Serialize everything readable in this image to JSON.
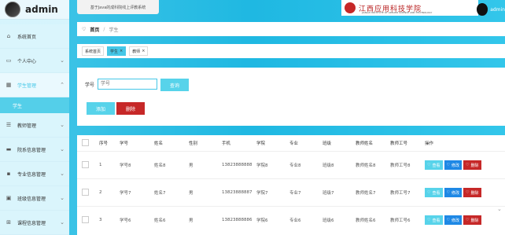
{
  "sidebar": {
    "brand": "admin",
    "items": [
      {
        "label": "系统首页",
        "icon": "home-icon"
      },
      {
        "label": "个人中心",
        "icon": "user-card-icon"
      },
      {
        "label": "学生管理",
        "icon": "grid-icon",
        "active": true
      },
      {
        "label": "学生",
        "submenu": true
      },
      {
        "label": "教师管理",
        "icon": "sliders-icon"
      },
      {
        "label": "院系信息管理",
        "icon": "message-icon"
      },
      {
        "label": "专业信息管理",
        "icon": "briefcase-icon"
      },
      {
        "label": "班级信息管理",
        "icon": "screen-icon"
      },
      {
        "label": "课程信息管理",
        "icon": "apps-icon"
      }
    ]
  },
  "header": {
    "system_title": "基于Java的成科院线上评教系统",
    "school_cn": "江西应用科技学院",
    "school_en": "JIANGXI INSTITUTE OF APPLIED SCIENCE AND TECHNOLOGY",
    "username": "admin"
  },
  "breadcrumb": {
    "home": "首页",
    "current": "学生"
  },
  "tags": [
    {
      "label": "系统首页"
    },
    {
      "label": "学生",
      "active": true
    },
    {
      "label": "教师"
    }
  ],
  "search": {
    "label": "学号",
    "placeholder": "学号",
    "query": "查询",
    "add": "添加",
    "delete": "删除"
  },
  "table": {
    "headers": [
      "序号",
      "学号",
      "姓名",
      "性别",
      "手机",
      "学院",
      "专业",
      "班级",
      "教师姓名",
      "教师工号",
      "操作"
    ],
    "rows": [
      {
        "idx": "1",
        "id": "学号8",
        "name": "姓名8",
        "sex": "男",
        "phone": "13823888888",
        "college": "学院8",
        "major": "专业8",
        "class": "班级8",
        "tname": "教师姓名8",
        "tid": "教师工号8"
      },
      {
        "idx": "2",
        "id": "学号7",
        "name": "姓名7",
        "sex": "男",
        "phone": "13823888887",
        "college": "学院7",
        "major": "专业7",
        "class": "班级7",
        "tname": "教师姓名7",
        "tid": "教师工号7"
      },
      {
        "idx": "3",
        "id": "学号6",
        "name": "姓名6",
        "sex": "男",
        "phone": "13823888886",
        "college": "学院6",
        "major": "专业6",
        "class": "班级6",
        "tname": "教师姓名6",
        "tid": "教师工号6"
      }
    ],
    "actions": {
      "view": "查看",
      "edit": "修改",
      "delete": "删除"
    }
  },
  "colors": {
    "accent": "#45c7e7",
    "danger": "#c62828",
    "primary": "#1e88e5"
  }
}
